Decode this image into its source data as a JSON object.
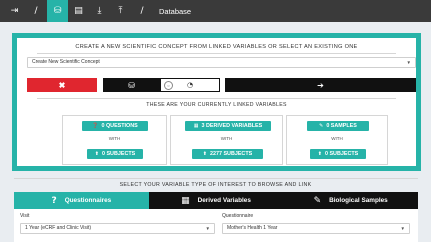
{
  "toolbar": {
    "sep1": "/",
    "sep2": "/",
    "title": "Database"
  },
  "concept": {
    "heading": "CREATE A NEW SCIENTIFIC CONCEPT FROM LINKED VARIABLES OR SELECT AN EXISTING ONE",
    "select_value": "Create New Scientific Concept",
    "cancel_icon": "✖",
    "go_icon": "➔"
  },
  "linked": {
    "heading": "THESE ARE YOUR CURRENTLY LINKED VARIABLES",
    "boxes": [
      {
        "top_label": "0 QUESTIONS",
        "with": "WITH",
        "bottom_label": "0 SUBJECTS"
      },
      {
        "top_label": "3 DERIVED VARIABLES",
        "with": "WITH",
        "bottom_label": "2277 SUBJECTS"
      },
      {
        "top_label": "0 SAMPLES",
        "with": "WITH",
        "bottom_label": "0 SUBJECTS"
      }
    ]
  },
  "browse": {
    "heading": "SELECT YOUR VARIABLE TYPE OF INTEREST TO BROWSE AND LINK",
    "tabs": [
      {
        "label": "Questionnaires"
      },
      {
        "label": "Derived Variables"
      },
      {
        "label": "Biological Samples"
      }
    ],
    "visit_label": "Visit",
    "visit_value": "1 Year (eCRF and Clinic Visit)",
    "questionnaire_label": "Questionnaire",
    "questionnaire_value": "Mother's Health 1 Year"
  },
  "icons": {
    "toolbar": [
      "sign-in-icon",
      "database-icon",
      "file-icon",
      "download-icon",
      "upload-icon"
    ],
    "concept": [
      "close-icon",
      "database-icon",
      "pie-chart-icon",
      "arrow-right-icon"
    ],
    "linked": [
      "question-circle-icon",
      "calculator-icon",
      "eyedropper-icon",
      "arrow-up-icon"
    ],
    "tabs": [
      "question-icon",
      "calculator-icon",
      "eyedropper-icon"
    ]
  },
  "colors": {
    "accent": "#26b3a8",
    "danger": "#e0262f",
    "toolbar_bg": "#3a3a3a",
    "dark_button": "#111111"
  }
}
